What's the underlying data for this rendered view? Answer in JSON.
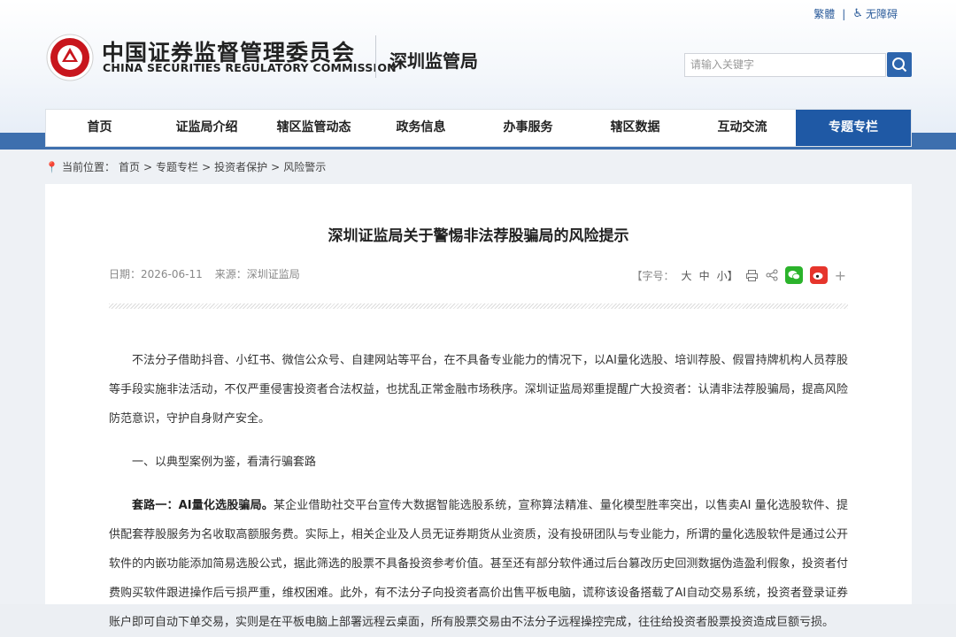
{
  "header": {
    "util": {
      "traditional": "繁體",
      "separator": "|",
      "accessibility": "无障碍"
    },
    "logo_cn": "中国证券监督管理委员会",
    "logo_en": "CHINA SECURITIES REGULATORY COMMISSION",
    "bureau": "深圳监管局",
    "search": {
      "placeholder": "请输入关键字"
    }
  },
  "nav": {
    "items": [
      "首页",
      "证监局介绍",
      "辖区监管动态",
      "政务信息",
      "办事服务",
      "辖区数据",
      "互动交流",
      "专题专栏"
    ],
    "active_index": 7
  },
  "breadcrumb": {
    "prefix": "当前位置：",
    "path": [
      "首页",
      "专题专栏",
      "投资者保护",
      "风险警示"
    ],
    "sep": " > "
  },
  "article": {
    "title": "深圳证监局关于警惕非法荐股骗局的风险提示",
    "date": "日期：2026-06-11",
    "source": "来源：深圳证监局",
    "font_label": "【字号：",
    "font_sizes": [
      "大",
      "中",
      "小】"
    ],
    "paragraphs": {
      "intro": "不法分子借助抖音、小红书、微信公众号、自建网站等平台，在不具备专业能力的情况下，以AI量化选股、培训荐股、假冒持牌机构人员荐股等手段实施非法活动，不仅严重侵害投资者合法权益，也扰乱正常金融市场秩序。深圳证监局郑重提醒广大投资者：认清非法荐股骗局，提高风险防范意识，守护自身财产安全。",
      "section1": "一、以典型案例为鉴，看清行骗套路",
      "trick1_label": "套路一：AI量化选股骗局。",
      "trick1_text": "某企业借助社交平台宣传大数据智能选股系统，宣称算法精准、量化模型胜率突出，以售卖AI 量化选股软件、提供配套荐股服务为名收取高额服务费。实际上，相关企业及人员无证券期货从业资质，没有投研团队与专业能力，所谓的量化选股软件是通过公开软件的内嵌功能添加简易选股公式，据此筛选的股票不具备投资参考价值。甚至还有部分软件通过后台篡改历史回测数据伪造盈利假象，投资者付费购买软件跟进操作后亏损严重，维权困难。此外，有不法分子向投资者高价出售平板电脑，谎称该设备搭载了AI自动交易系统，投资者登录证券账户即可自动下单交易，实则是在平板电脑上部署远程云桌面，所有股票交易由不法分子远程操控完成，往往给投资者股票投资造成巨额亏损。"
    }
  },
  "colors": {
    "brand_blue": "#1f59a5",
    "band_blue": "#3d6fae",
    "wechat": "#2bb32b",
    "weibo": "#e6352c"
  }
}
